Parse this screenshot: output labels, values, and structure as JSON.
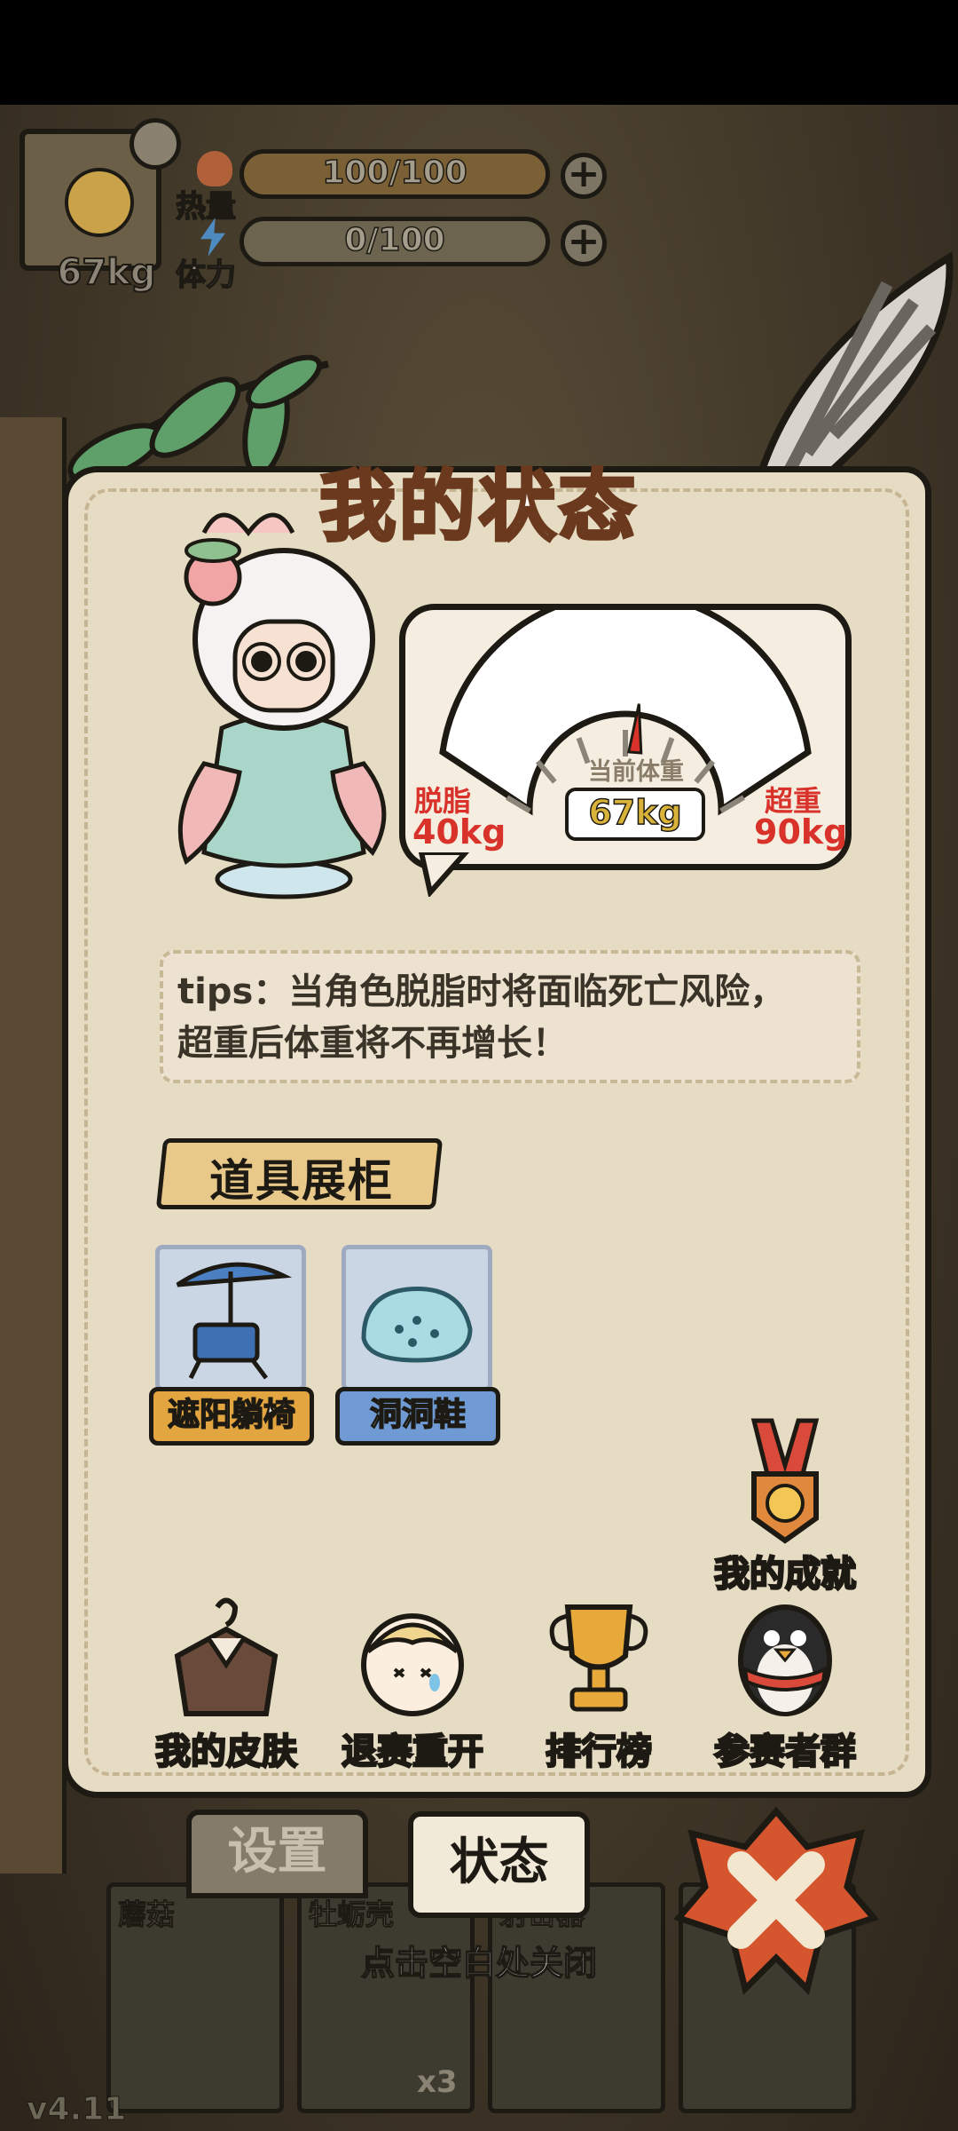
{
  "hud": {
    "weight": "67kg",
    "calories_label": "热量",
    "calories_value": "100/100",
    "calories_fill": 1.0,
    "stamina_label": "体力",
    "stamina_value": "0/100",
    "stamina_fill": 0.0,
    "plus": "+"
  },
  "dialog": {
    "title": "我的状态",
    "gauge": {
      "low_label": "脱脂",
      "low_value": "40kg",
      "high_label": "超重",
      "high_value": "90kg",
      "current_label": "当前体重",
      "current_value": "67kg",
      "min": 40,
      "max": 90,
      "current": 67
    },
    "tips_line1": "tips：当角色脱脂时将面临死亡风险，",
    "tips_line2": "超重后体重将不再增长！",
    "showcase_title": "道具展柜",
    "items": [
      {
        "label": "遮阳躺椅",
        "icon": "beach-chair-umbrella-icon"
      },
      {
        "label": "洞洞鞋",
        "icon": "clog-shoe-icon"
      }
    ],
    "achievement_label": "我的成就",
    "actions": [
      {
        "label": "我的皮肤",
        "icon": "clothes-hanger-icon"
      },
      {
        "label": "退赛重开",
        "icon": "crying-girl-icon"
      },
      {
        "label": "排行榜",
        "icon": "trophy-icon"
      },
      {
        "label": "参赛者群",
        "icon": "penguin-icon"
      }
    ]
  },
  "tabs": {
    "settings": "设置",
    "status": "状态"
  },
  "inventory": {
    "slots": [
      "蘑菇",
      "牡蛎壳",
      "射击器"
    ],
    "oyster_count": "x3"
  },
  "close_hint": "点击空白处关闭",
  "version": "v4.11",
  "colors": {
    "danger_red": "#d8322b",
    "gold": "#d9b23a",
    "paper": "#e6dbc3",
    "outline": "#1d1a14"
  }
}
